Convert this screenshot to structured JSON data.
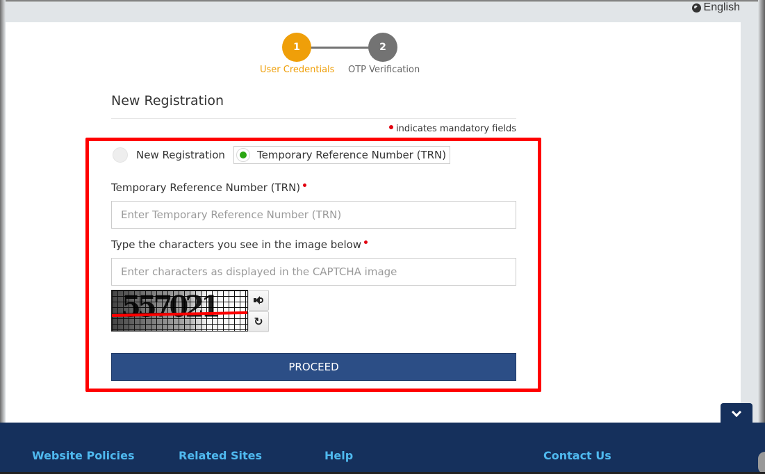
{
  "language": {
    "icon": "globe-icon",
    "label": "English"
  },
  "stepper": {
    "steps": [
      {
        "number": "1",
        "label": "User Credentials",
        "state": "active",
        "color": "#ef9f09"
      },
      {
        "number": "2",
        "label": "OTP Verification",
        "state": "pending",
        "color": "#737373"
      }
    ]
  },
  "form": {
    "title": "New Registration",
    "mandatory_note": "indicates mandatory fields",
    "radio_options": [
      {
        "label": "New Registration",
        "selected": false
      },
      {
        "label": "Temporary Reference Number (TRN)",
        "selected": true
      }
    ],
    "trn_field": {
      "label": "Temporary Reference Number (TRN)",
      "placeholder": "Enter Temporary Reference Number (TRN)",
      "value": ""
    },
    "captcha_field": {
      "label": "Type the characters you see in the image below",
      "placeholder": "Enter characters as displayed in the CAPTCHA image",
      "value": ""
    },
    "captcha": {
      "image_text": "557021",
      "audio_icon": "speaker-icon",
      "refresh_icon": "refresh-icon"
    },
    "submit_label": "PROCEED",
    "highlight_color": "#ff0000",
    "button_color": "#2c4e86"
  },
  "footer": {
    "links": [
      "Website Policies",
      "Related Sites",
      "Help",
      "Contact Us"
    ],
    "background": "#15305c",
    "link_color": "#4fb9ef"
  }
}
